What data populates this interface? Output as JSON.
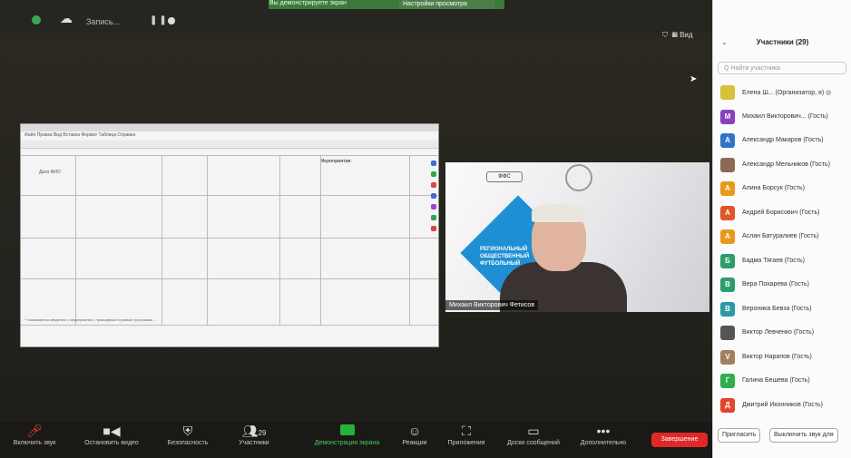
{
  "topbar": {
    "rec_label": "Запись...",
    "share_banner": "Вы демонстрируете экран",
    "view_options": "Настройки просмотра",
    "view_label": "Вид"
  },
  "document": {
    "menu": "Файл  Правка  Вид  Вставка  Формат  Таблица  Справка",
    "header_left": "Дата  ФИО",
    "header_right": "Мероприятия",
    "notes": "* Указываются сведения о мероприятиях, проводимых в рамках программы ..."
  },
  "video": {
    "name_tag": "Михаил Викторович Фетисов",
    "banner": "РЕГИОНАЛЬНЫЙ ОБЩЕСТВЕННЫЙ ФУТБОЛЬНЫЙ"
  },
  "panel": {
    "title": "Участники (29)",
    "search_placeholder": "Q Найти участника",
    "participants": [
      {
        "initial": "",
        "name": "Елена Ш... (Организатор, я) ◎",
        "color": "#d5c23a"
      },
      {
        "initial": "M",
        "name": "Михаил Викторович... (Гость)",
        "color": "#8a3fc1"
      },
      {
        "initial": "A",
        "name": "Александр Макаров (Гость)",
        "color": "#2f74c9"
      },
      {
        "initial": "",
        "name": "Александр Мельников (Гость)",
        "color": "#8b6a55"
      },
      {
        "initial": "A",
        "name": "Алина Борсук (Гость)",
        "color": "#e89a1c"
      },
      {
        "initial": "A",
        "name": "Андрей Борисович (Гость)",
        "color": "#e0562b"
      },
      {
        "initial": "A",
        "name": "Аслан Батуралиев (Гость)",
        "color": "#e89a1c"
      },
      {
        "initial": "Б",
        "name": "Бадма Тягаев (Гость)",
        "color": "#2a9d6b"
      },
      {
        "initial": "В",
        "name": "Вера Похарева (Гость)",
        "color": "#2a9d6b"
      },
      {
        "initial": "В",
        "name": "Вероника Бевза (Гость)",
        "color": "#2a9aa8"
      },
      {
        "initial": "",
        "name": "Виктор Левченко (Гость)",
        "color": "#555555"
      },
      {
        "initial": "V",
        "name": "Виктор Нарапов (Гость)",
        "color": "#a0805c"
      },
      {
        "initial": "Г",
        "name": "Галина Бешева (Гость)",
        "color": "#2fae4c"
      },
      {
        "initial": "Д",
        "name": "Дмитрий Иконников (Гость)",
        "color": "#e0462b"
      }
    ],
    "invite_label": "Пригласить",
    "mute_all_label": "Выключить звук для"
  },
  "toolbar": {
    "unmute": "Включить звук",
    "stop_video": "Остановить видео",
    "security": "Безопасность",
    "participants": "Участники",
    "participants_count": "29",
    "share": "Демонстрация экрана",
    "reactions": "Реакции",
    "apps": "Приложения",
    "whiteboards": "Доски сообщений",
    "more": "Дополнительно",
    "end": "Завершение"
  }
}
